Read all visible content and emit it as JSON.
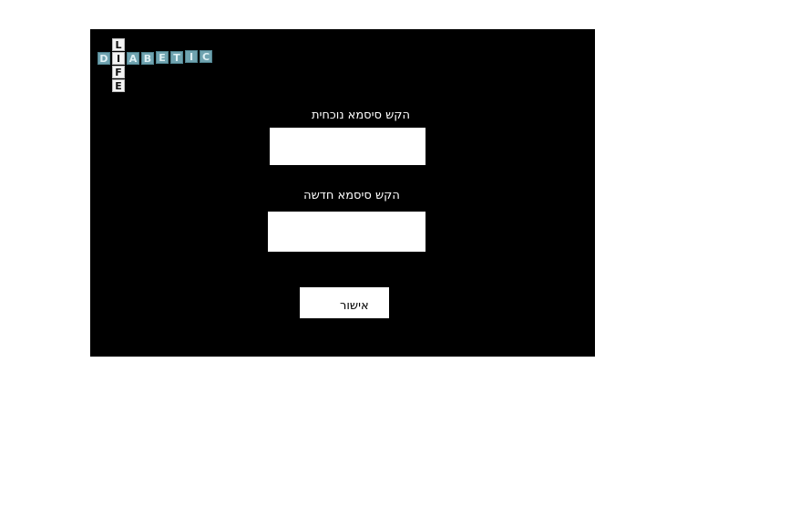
{
  "logo": {
    "horizontal_word": [
      "D",
      "I",
      "A",
      "B",
      "E",
      "T",
      "I",
      "C"
    ],
    "vertical_word": [
      "L",
      "I",
      "F",
      "E"
    ]
  },
  "form": {
    "current_password_label": "הקש סיסמא נוכחית",
    "current_password_value": "",
    "new_password_label": "הקש סיסמא חדשה",
    "new_password_value": "",
    "confirm_button_label": "אישור"
  },
  "colors": {
    "panel_background": "#000000",
    "page_background": "#ffffff",
    "logo_tile_blue": "#6fa3b0",
    "logo_tile_white": "#f4f4f4"
  }
}
